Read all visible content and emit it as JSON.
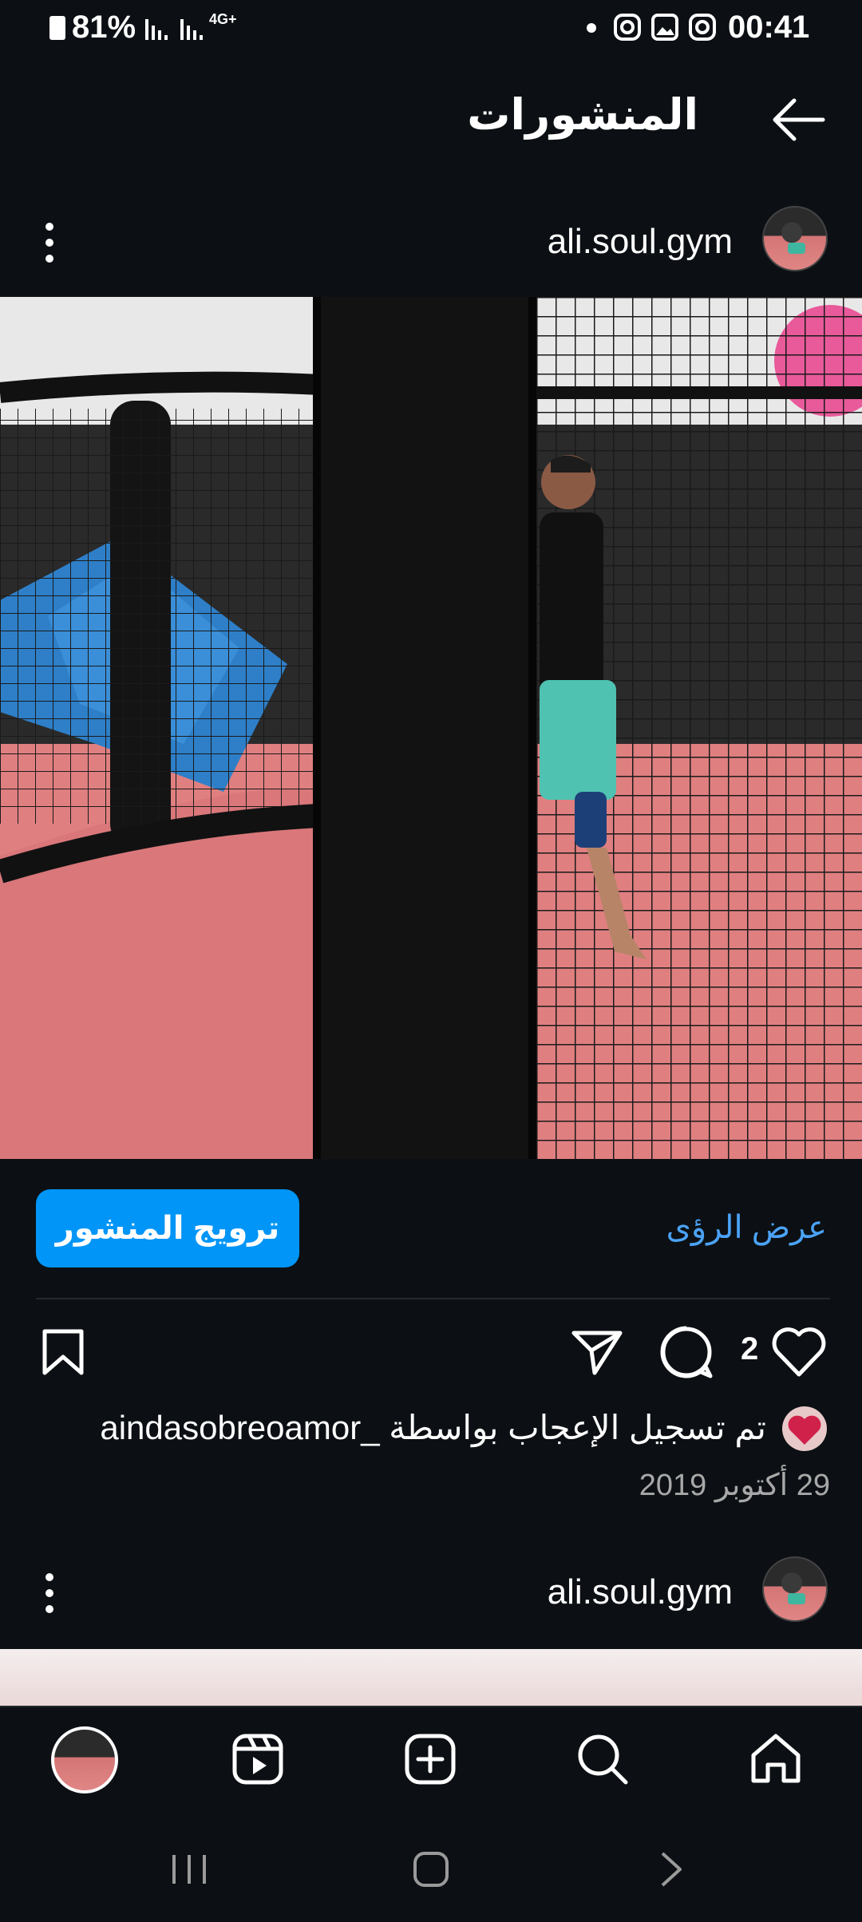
{
  "status_bar": {
    "battery": "81%",
    "network": "4G+",
    "time": "00:41"
  },
  "header": {
    "title": "المنشورات",
    "back_icon": "arrow-left-icon"
  },
  "post": {
    "username": "ali.soul.gym",
    "menu_icon": "more-vertical-icon",
    "promote_label": "ترويج المنشور",
    "insights_label": "عرض الرؤى",
    "like_count": "2",
    "liked_by": "تم تسجيل الإعجاب بواسطة _aindasobreoamor",
    "date": "29 أكتوبر 2019"
  },
  "next_post": {
    "username": "ali.soul.gym"
  },
  "bottom_nav": {
    "items": [
      "home-icon",
      "search-icon",
      "create-icon",
      "reels-icon",
      "profile-avatar"
    ]
  },
  "system_nav": {
    "items": [
      "recents-icon",
      "home-button-icon",
      "back-icon"
    ]
  },
  "colors": {
    "background": "#0c1014",
    "accent": "#0095f6",
    "link": "#4ba3f8"
  }
}
